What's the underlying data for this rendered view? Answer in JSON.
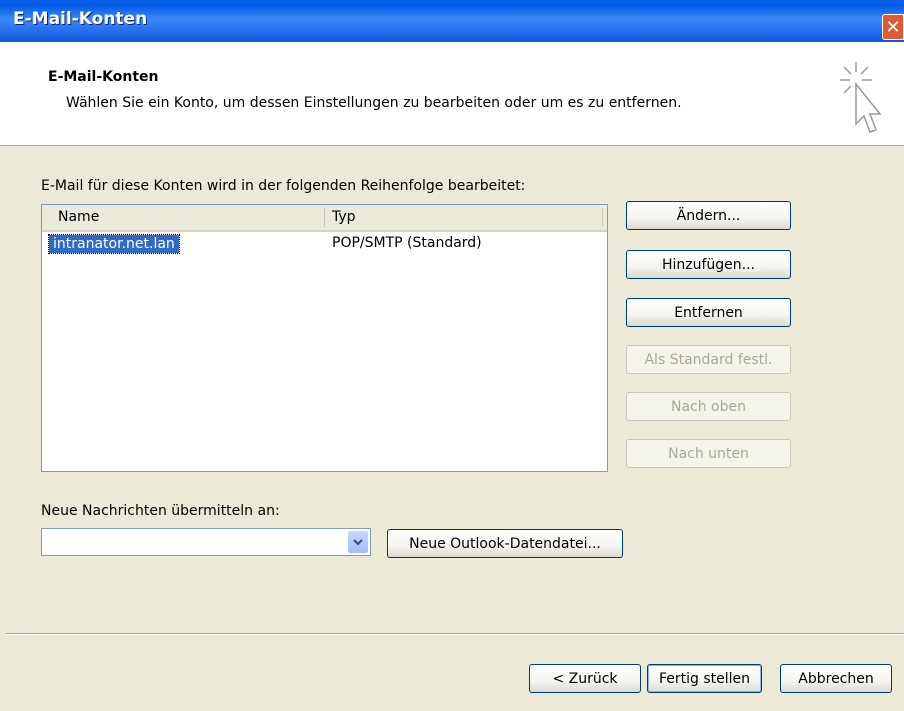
{
  "window": {
    "title": "E-Mail-Konten"
  },
  "header": {
    "title": "E-Mail-Konten",
    "subtitle": "Wählen Sie ein Konto, um dessen Einstellungen zu bearbeiten oder um es zu entfernen."
  },
  "accounts": {
    "label": "E-Mail für diese Konten wird in der folgenden Reihenfolge bearbeitet:",
    "columns": {
      "name": "Name",
      "type": "Typ"
    },
    "rows": [
      {
        "name": "intranator.net.lan",
        "type": "POP/SMTP (Standard)"
      }
    ]
  },
  "side_buttons": {
    "change": "Ändern...",
    "add": "Hinzufügen...",
    "remove": "Entfernen",
    "set_default": "Als Standard festl.",
    "move_up": "Nach oben",
    "move_down": "Nach unten"
  },
  "delivery": {
    "label": "Neue Nachrichten übermitteln an:",
    "selected": "",
    "new_file_button": "Neue Outlook-Datendatei..."
  },
  "footer": {
    "back": "< Zurück",
    "finish": "Fertig stellen",
    "cancel": "Abbrechen"
  },
  "colors": {
    "titlebar": "#0058e6",
    "selection": "#316ac5",
    "close": "#e25a35"
  }
}
